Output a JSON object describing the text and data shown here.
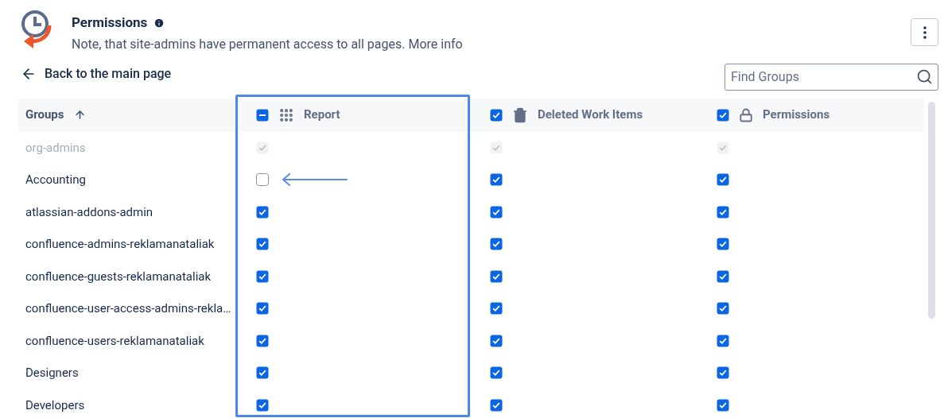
{
  "header": {
    "title": "Permissions",
    "note": "Note, that site-admins have permanent access to all pages. More info"
  },
  "back_link": "Back to the main page",
  "search": {
    "placeholder": "Find Groups"
  },
  "table": {
    "columns": [
      {
        "label": "Groups"
      },
      {
        "label": "Report",
        "checked": false,
        "indeterminate": true
      },
      {
        "label": "Deleted Work Items",
        "checked": true,
        "indeterminate": false
      },
      {
        "label": "Permissions",
        "checked": true,
        "indeterminate": false
      }
    ],
    "rows": [
      {
        "name": "org-admins",
        "disabled": true,
        "cells": [
          {
            "checked": true
          },
          {
            "checked": true
          },
          {
            "checked": true
          }
        ]
      },
      {
        "name": "Accounting",
        "disabled": false,
        "cells": [
          {
            "checked": false
          },
          {
            "checked": true
          },
          {
            "checked": true
          }
        ]
      },
      {
        "name": "atlassian-addons-admin",
        "disabled": false,
        "cells": [
          {
            "checked": true
          },
          {
            "checked": true
          },
          {
            "checked": true
          }
        ]
      },
      {
        "name": "confluence-admins-reklamanataliak",
        "disabled": false,
        "cells": [
          {
            "checked": true
          },
          {
            "checked": true
          },
          {
            "checked": true
          }
        ]
      },
      {
        "name": "confluence-guests-reklamanataliak",
        "disabled": false,
        "cells": [
          {
            "checked": true
          },
          {
            "checked": true
          },
          {
            "checked": true
          }
        ]
      },
      {
        "name": "confluence-user-access-admins-rekla…",
        "disabled": false,
        "cells": [
          {
            "checked": true
          },
          {
            "checked": true
          },
          {
            "checked": true
          }
        ]
      },
      {
        "name": "confluence-users-reklamanataliak",
        "disabled": false,
        "cells": [
          {
            "checked": true
          },
          {
            "checked": true
          },
          {
            "checked": true
          }
        ]
      },
      {
        "name": "Designers",
        "disabled": false,
        "cells": [
          {
            "checked": true
          },
          {
            "checked": true
          },
          {
            "checked": true
          }
        ]
      },
      {
        "name": "Developers",
        "disabled": false,
        "cells": [
          {
            "checked": true
          },
          {
            "checked": true
          },
          {
            "checked": true
          }
        ]
      }
    ]
  }
}
